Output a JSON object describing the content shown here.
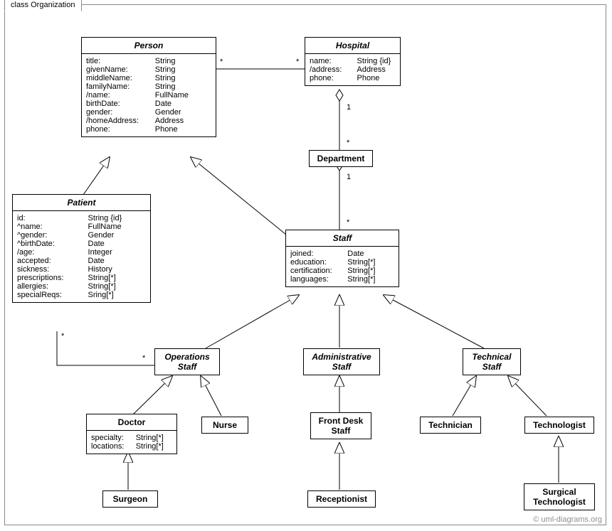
{
  "frame": {
    "label": "class Organization"
  },
  "copyright": "© uml-diagrams.org",
  "classes": {
    "person": {
      "name": "Person",
      "attrs": [
        {
          "n": "title:",
          "t": "String"
        },
        {
          "n": "givenName:",
          "t": "String"
        },
        {
          "n": "middleName:",
          "t": "String"
        },
        {
          "n": "familyName:",
          "t": "String"
        },
        {
          "n": "/name:",
          "t": "FullName"
        },
        {
          "n": "birthDate:",
          "t": "Date"
        },
        {
          "n": "gender:",
          "t": "Gender"
        },
        {
          "n": "/homeAddress:",
          "t": "Address"
        },
        {
          "n": "phone:",
          "t": "Phone"
        }
      ]
    },
    "hospital": {
      "name": "Hospital",
      "attrs": [
        {
          "n": "name:",
          "t": "String {id}"
        },
        {
          "n": "/address:",
          "t": "Address"
        },
        {
          "n": "phone:",
          "t": "Phone"
        }
      ]
    },
    "department": {
      "name": "Department"
    },
    "patient": {
      "name": "Patient",
      "attrs": [
        {
          "n": "id:",
          "t": "String {id}"
        },
        {
          "n": "^name:",
          "t": "FullName"
        },
        {
          "n": "^gender:",
          "t": "Gender"
        },
        {
          "n": "^birthDate:",
          "t": "Date"
        },
        {
          "n": "/age:",
          "t": "Integer"
        },
        {
          "n": "accepted:",
          "t": "Date"
        },
        {
          "n": "sickness:",
          "t": "History"
        },
        {
          "n": "prescriptions:",
          "t": "String[*]"
        },
        {
          "n": "allergies:",
          "t": "String[*]"
        },
        {
          "n": "specialReqs:",
          "t": "Sring[*]"
        }
      ]
    },
    "staff": {
      "name": "Staff",
      "attrs": [
        {
          "n": "joined:",
          "t": "Date"
        },
        {
          "n": "education:",
          "t": "String[*]"
        },
        {
          "n": "certification:",
          "t": "String[*]"
        },
        {
          "n": "languages:",
          "t": "String[*]"
        }
      ]
    },
    "opsStaff": {
      "name": "Operations\nStaff"
    },
    "adminStaff": {
      "name": "Administrative\nStaff"
    },
    "techStaff": {
      "name": "Technical\nStaff"
    },
    "doctor": {
      "name": "Doctor",
      "attrs": [
        {
          "n": "specialty:",
          "t": "String[*]"
        },
        {
          "n": "locations:",
          "t": "String[*]"
        }
      ]
    },
    "nurse": {
      "name": "Nurse"
    },
    "frontDesk": {
      "name": "Front Desk\nStaff"
    },
    "technician": {
      "name": "Technician"
    },
    "technologist": {
      "name": "Technologist"
    },
    "surgeon": {
      "name": "Surgeon"
    },
    "receptionist": {
      "name": "Receptionist"
    },
    "surgTech": {
      "name": "Surgical\nTechnologist"
    }
  },
  "multiplicities": {
    "personHospitalLeft": "*",
    "personHospitalRight": "*",
    "hospitalDeptTop": "1",
    "hospitalDeptBottom": "*",
    "deptStaffTop": "1",
    "deptStaffBottom": "*",
    "patientOpsLeft": "*",
    "patientOpsRight": "*"
  }
}
